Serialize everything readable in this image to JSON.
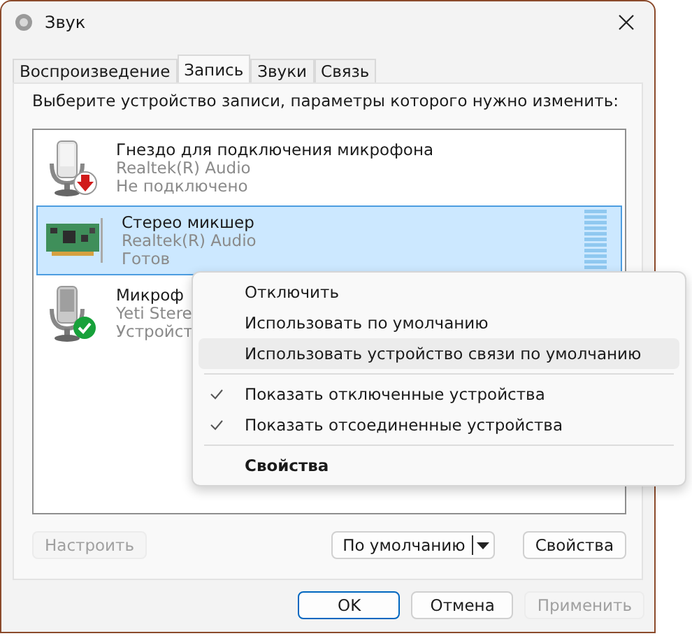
{
  "window": {
    "title": "Звук"
  },
  "tabs": [
    {
      "label": "Воспроизведение",
      "selected": false
    },
    {
      "label": "Запись",
      "selected": true
    },
    {
      "label": "Звуки",
      "selected": false
    },
    {
      "label": "Связь",
      "selected": false
    }
  ],
  "instruction": "Выберите устройство записи, параметры которого нужно изменить:",
  "devices": [
    {
      "name": "Гнездо для подключения микрофона",
      "driver": "Realtek(R) Audio",
      "status": "Не подключено",
      "kind": "jack",
      "default_device": false,
      "selected": false
    },
    {
      "name": "Стерео микшер",
      "driver": "Realtek(R) Audio",
      "status": "Готов",
      "kind": "mixer",
      "default_device": false,
      "selected": true
    },
    {
      "name": "Микроф",
      "driver": "Yeti Stere",
      "status": "Устройст",
      "kind": "mic",
      "default_device": true,
      "selected": false
    }
  ],
  "context_menu": {
    "groups": [
      [
        {
          "label": "Отключить",
          "checked": false,
          "selected": false,
          "default": false
        },
        {
          "label": "Использовать по умолчанию",
          "checked": false,
          "selected": false,
          "default": false
        },
        {
          "label": "Использовать устройство связи по умолчанию",
          "checked": false,
          "selected": true,
          "default": false
        }
      ],
      [
        {
          "label": "Показать отключенные устройства",
          "checked": true,
          "selected": false,
          "default": false
        },
        {
          "label": "Показать отсоединенные устройства",
          "checked": true,
          "selected": false,
          "default": false
        }
      ],
      [
        {
          "label": "Свойства",
          "checked": false,
          "selected": false,
          "default": true
        }
      ]
    ]
  },
  "panel_buttons": {
    "configure": {
      "label": "Настроить",
      "disabled": true
    },
    "default_dropdown": {
      "label": "По умолчанию"
    },
    "properties": {
      "label": "Свойства",
      "disabled": false
    }
  },
  "dialog_buttons": [
    {
      "label": "OK",
      "disabled": false,
      "primary": true
    },
    {
      "label": "Отмена",
      "disabled": false,
      "primary": false
    },
    {
      "label": "Применить",
      "disabled": true,
      "primary": false
    }
  ]
}
